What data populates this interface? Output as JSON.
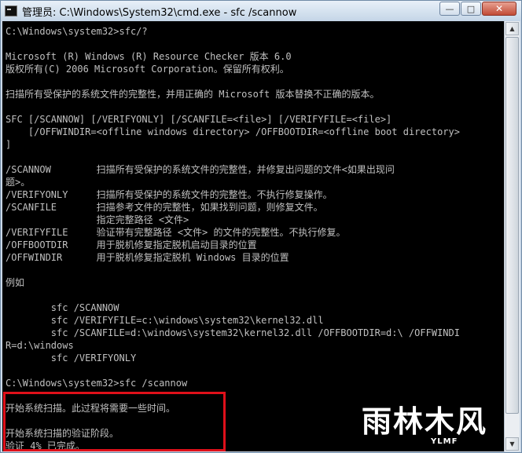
{
  "window": {
    "title": "管理员: C:\\Windows\\System32\\cmd.exe - sfc  /scannow",
    "minimize": "—",
    "maximize": "□",
    "close": "✕"
  },
  "console": {
    "lines": [
      "C:\\Windows\\system32>sfc/?",
      "",
      "Microsoft (R) Windows (R) Resource Checker 版本 6.0",
      "版权所有(C) 2006 Microsoft Corporation。保留所有权利。",
      "",
      "扫描所有受保护的系统文件的完整性，并用正确的 Microsoft 版本替换不正确的版本。",
      "",
      "SFC [/SCANNOW] [/VERIFYONLY] [/SCANFILE=<file>] [/VERIFYFILE=<file>]",
      "    [/OFFWINDIR=<offline windows directory> /OFFBOOTDIR=<offline boot directory>",
      "]",
      "",
      "/SCANNOW        扫描所有受保护的系统文件的完整性，并修复出问题的文件<如果出现问",
      "题>。",
      "/VERIFYONLY     扫描所有受保护的系统文件的完整性。不执行修复操作。",
      "/SCANFILE       扫描参考文件的完整性，如果找到问题，则修复文件。",
      "                指定完整路径 <文件>",
      "/VERIFYFILE     验证带有完整路径 <文件> 的文件的完整性。不执行修复。",
      "/OFFBOOTDIR     用于脱机修复指定脱机启动目录的位置",
      "/OFFWINDIR      用于脱机修复指定脱机 Windows 目录的位置",
      "",
      "例如",
      "",
      "        sfc /SCANNOW",
      "        sfc /VERIFYFILE=c:\\windows\\system32\\kernel32.dll",
      "        sfc /SCANFILE=d:\\windows\\system32\\kernel32.dll /OFFBOOTDIR=d:\\ /OFFWINDI",
      "R=d:\\windows",
      "        sfc /VERIFYONLY",
      "",
      "C:\\Windows\\system32>sfc /scannow",
      "",
      "开始系统扫描。此过程将需要一些时间。",
      "",
      "开始系统扫描的验证阶段。",
      "验证 4% 已完成。"
    ]
  },
  "watermark": {
    "main": "雨林木风",
    "sub": "YLMF"
  }
}
